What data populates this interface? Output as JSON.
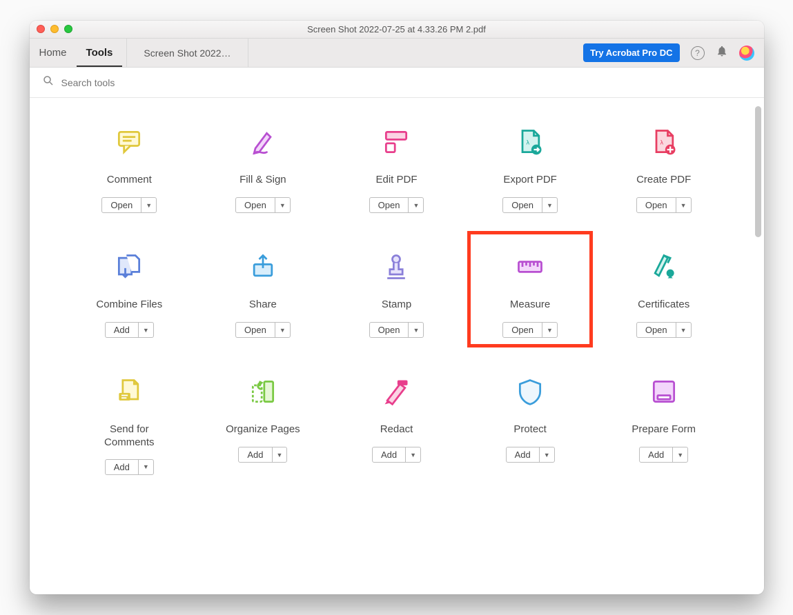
{
  "window_title": "Screen Shot 2022-07-25 at 4.33.26 PM 2.pdf",
  "nav": {
    "home": "Home",
    "tools": "Tools"
  },
  "doc_tab": "Screen Shot 2022…",
  "header": {
    "try_button": "Try Acrobat Pro DC"
  },
  "search": {
    "placeholder": "Search tools"
  },
  "tools": [
    {
      "label": "Comment",
      "button": "Open",
      "icon": "comment",
      "highlight": false
    },
    {
      "label": "Fill & Sign",
      "button": "Open",
      "icon": "fillsign",
      "highlight": false
    },
    {
      "label": "Edit PDF",
      "button": "Open",
      "icon": "editpdf",
      "highlight": false
    },
    {
      "label": "Export PDF",
      "button": "Open",
      "icon": "exportpdf",
      "highlight": false
    },
    {
      "label": "Create PDF",
      "button": "Open",
      "icon": "createpdf",
      "highlight": false
    },
    {
      "label": "Combine Files",
      "button": "Add",
      "icon": "combine",
      "highlight": false
    },
    {
      "label": "Share",
      "button": "Open",
      "icon": "share",
      "highlight": false
    },
    {
      "label": "Stamp",
      "button": "Open",
      "icon": "stamp",
      "highlight": false
    },
    {
      "label": "Measure",
      "button": "Open",
      "icon": "measure",
      "highlight": true
    },
    {
      "label": "Certificates",
      "button": "Open",
      "icon": "certificates",
      "highlight": false
    },
    {
      "label": "Send for\nComments",
      "button": "Add",
      "icon": "sendcomment",
      "highlight": false
    },
    {
      "label": "Organize Pages",
      "button": "Add",
      "icon": "organize",
      "highlight": false
    },
    {
      "label": "Redact",
      "button": "Add",
      "icon": "redact",
      "highlight": false
    },
    {
      "label": "Protect",
      "button": "Add",
      "icon": "protect",
      "highlight": false
    },
    {
      "label": "Prepare Form",
      "button": "Add",
      "icon": "prepareform",
      "highlight": false
    }
  ]
}
